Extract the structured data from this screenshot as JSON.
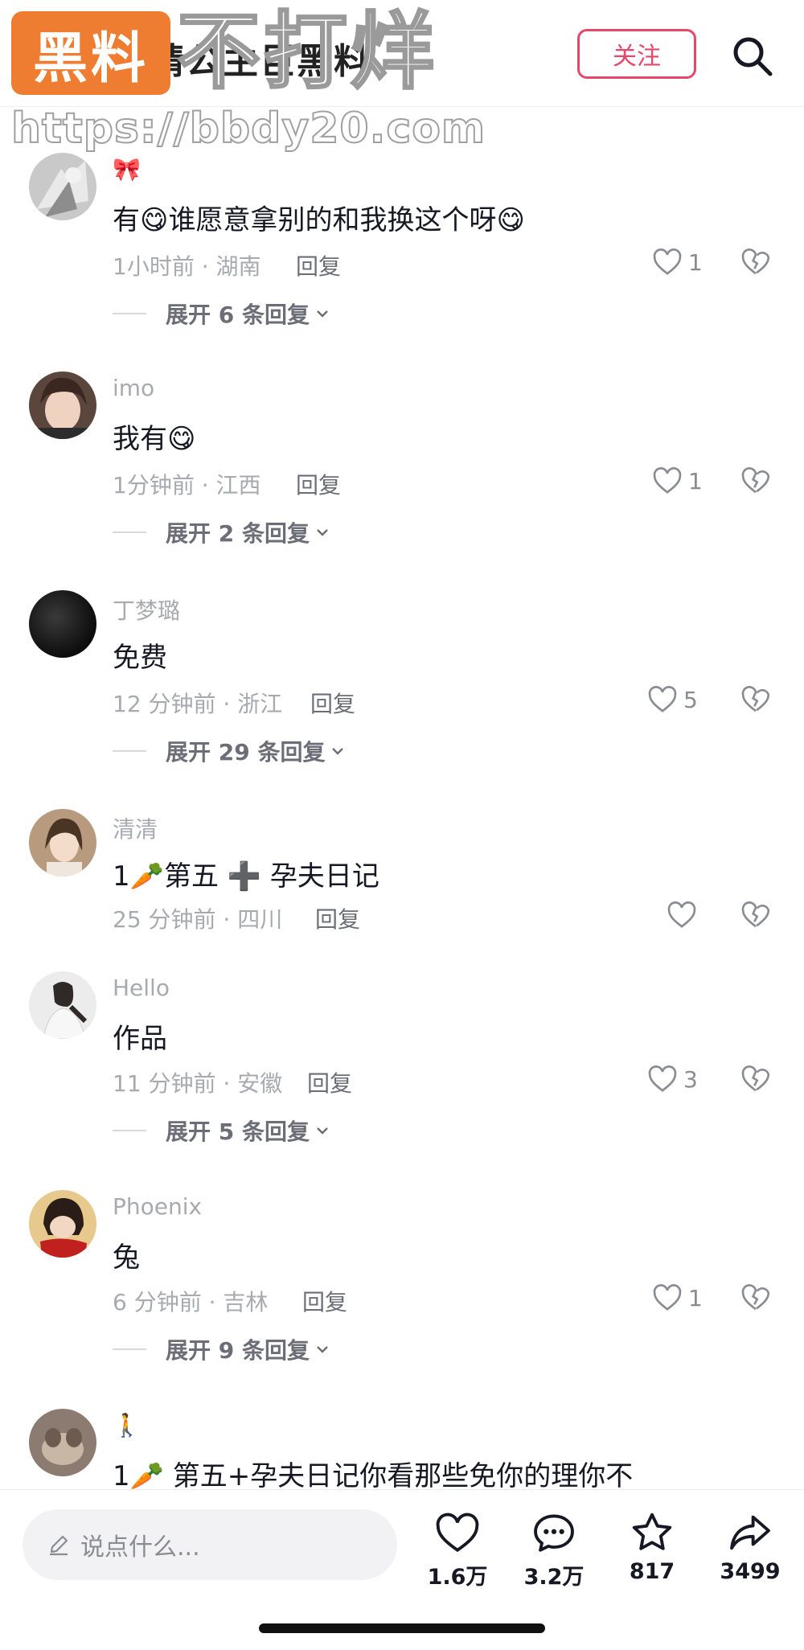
{
  "watermark": {
    "badge": "黑料",
    "title": "不打烊",
    "url": "https://bbdy20.com"
  },
  "header": {
    "title": "婧公主巨黑料",
    "follow_label": "关注"
  },
  "comments": [
    {
      "username": "🎀",
      "content": "有😋谁愿意拿别的和我换这个呀😋",
      "time_location": "1小时前 · 湖南",
      "reply_label": "回复",
      "likes": "1",
      "expand": "展开 6 条回复"
    },
    {
      "username": "imo",
      "content": "我有😋",
      "time_location": "1分钟前 · 江西",
      "reply_label": "回复",
      "likes": "1",
      "expand": "展开 2 条回复"
    },
    {
      "username": "丁梦璐",
      "content": "免费",
      "time_location": "12 分钟前 · 浙江",
      "reply_label": "回复",
      "likes": "5",
      "expand": "展开 29 条回复"
    },
    {
      "username": "清清",
      "content": "1🥕第五 ➕ 孕夫日记",
      "time_location": "25 分钟前 · 四川",
      "reply_label": "回复",
      "likes": "",
      "expand": ""
    },
    {
      "username": "Hello",
      "content": "作品",
      "time_location": "11 分钟前 · 安徽",
      "reply_label": "回复",
      "likes": "3",
      "expand": "展开 5 条回复"
    },
    {
      "username": "Phoenix",
      "content": "兔",
      "time_location": "6 分钟前 · 吉林",
      "reply_label": "回复",
      "likes": "1",
      "expand": "展开 9 条回复"
    },
    {
      "username": "🚶",
      "content": "1🥕 第五+孕夫日记你看那些免你的理你不",
      "time_location": "",
      "reply_label": "",
      "likes": "",
      "expand": ""
    }
  ],
  "bottom_bar": {
    "input_placeholder": "说点什么...",
    "likes": "1.6万",
    "comments": "3.2万",
    "favorites": "817",
    "shares": "3499"
  },
  "colors": {
    "accent": "#e8476a",
    "watermark_orange": "#ef7d31",
    "muted_text": "#a8aab0"
  },
  "icons": [
    "back-arrow-icon",
    "search-icon",
    "heart-outline-icon",
    "broken-heart-icon",
    "chevron-down-icon",
    "pencil-icon",
    "comment-bubble-icon",
    "star-icon",
    "share-arrow-icon"
  ]
}
